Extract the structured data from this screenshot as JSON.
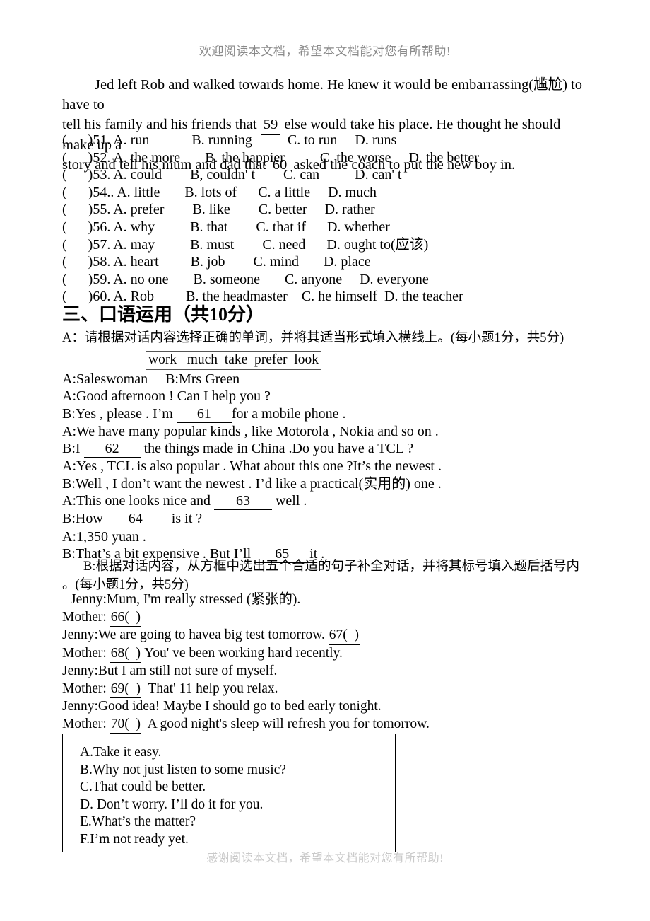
{
  "document": {
    "header_watermark": "欢迎阅读本文档，希望本文档能对您有所帮助!",
    "footer_watermark": "感谢阅读本文档，希望本文档能对您有所帮助!"
  },
  "cloze_passage": {
    "line1_indent": "     ",
    "line1_a": "Jed left Rob and walked towards home. He knew it would be embarrassing(尴尬) to have to",
    "line2_a": "tell his family and his friends that ",
    "line2_blank": "59",
    "line2_b": " else would take his place. He thought he should make up a",
    "line3_a": "story and tell his mum and dad that ",
    "line3_blank": "60",
    "line3_b": " asked the coach to put the new boy in."
  },
  "multiple_choice": {
    "rows": [
      "(      )51. A. run            B. running          C. to run     D. runs",
      "(      )52. A. the more       B. the happier          C. the worse     D. the better",
      "(      )53. A. could        B, couldn' t        C. can          D. can' t",
      "(      )54.. A. little       B. lots of      C. a little     D. much",
      "(      )55. A. prefer        B. like        C. better     D. rather",
      "(      )56. A. why          B. that        C. that if      D. whether",
      "(      )57. A. may          B. must        C. need      D. ought to(应该)",
      "(      )58. A. heart         B. job        C. mind       D. place",
      "(      )59. A. no one       B. someone       C. anyone     D. everyone",
      "(      )60. A. Rob         B. the headmaster    C. he himself  D. the teacher"
    ]
  },
  "section": {
    "heading_prefix": "三、口语运用（共",
    "heading_score": "10",
    "heading_suffix": "分）"
  },
  "part_a": {
    "instruction": "A：请根据对话内容选择正确的单词，并将其适当形式填入横线上。(每小题1分，共5分)",
    "word_bank": "work   much  take  prefer  look",
    "dialogue": [
      {
        "id": "roles",
        "text": "A:Saleswoman     B:Mrs Green"
      },
      {
        "id": "a1",
        "text": "A:Good afternoon ! Can I help you ?"
      },
      {
        "id": "b1_pre",
        "text": "B:Yes , please . I’m ",
        "blank": "61",
        "post": "for a mobile phone ."
      },
      {
        "id": "a2",
        "text": "A:We have many popular kinds , like Motorola , Nokia and so on ."
      },
      {
        "id": "b2_pre",
        "text": "B:I ",
        "blank": "62",
        "post": " the things made in China .Do you have a TCL ?"
      },
      {
        "id": "a3",
        "text": "A:Yes , TCL is also popular . What about this one ?It’s the newest ."
      },
      {
        "id": "b3",
        "text": "B:Well , I don’t want the newest . I’d like a practical(实用的) one ."
      },
      {
        "id": "a4_pre",
        "text": "A:This one looks nice and ",
        "blank": "63",
        "post": " well ."
      },
      {
        "id": "b4_pre",
        "text": "B:How ",
        "blank": "64",
        "post": "  is it ?"
      },
      {
        "id": "a5",
        "text": "A:1,350 yuan ."
      },
      {
        "id": "b5_pre",
        "text": "B:That’s a bit expensive . But I’ll ",
        "blank": "65",
        "post": "it ."
      }
    ]
  },
  "part_b": {
    "instruction_line1": "B:根据对话内容，从方框中选出五个合适的句子补全对话，并将其标号填入题后括号内",
    "instruction_line2": "。(每小题1分，共5分)",
    "dialogue": [
      {
        "id": "j1",
        "speaker": "Jenny:",
        "text": "Mum, I'm really stressed (紧张的)."
      },
      {
        "id": "m1",
        "speaker": "Mother: ",
        "blank": "66(  )",
        "post": ""
      },
      {
        "id": "j2",
        "speaker": "Jenny:",
        "text": "We are going to havea big test tomorrow. ",
        "blank": "67(  )",
        "post": ""
      },
      {
        "id": "m2",
        "speaker": "Mother: ",
        "blank": "68(  )",
        "post": " You' ve been working hard recently."
      },
      {
        "id": "j3",
        "speaker": "Jenny:",
        "text": "But I am still not sure of myself."
      },
      {
        "id": "m3",
        "speaker": "Mother: ",
        "blank": "69(  )",
        "post": "  That' 11 help you relax."
      },
      {
        "id": "j4",
        "speaker": "Jenny:",
        "text": "Good idea! Maybe I should go to bed early tonight."
      },
      {
        "id": "m4",
        "speaker": "Mother: ",
        "blank": "70(  )",
        "post": "  A good night's sleep will refresh you for tomorrow."
      }
    ],
    "options": [
      "A.Take it easy.",
      "B.Why not just listen to some music?",
      "C.That could be better.",
      "D. Don’t worry. I’ll do it for you.",
      "E.What’s the matter?",
      "F.I’m not ready yet."
    ]
  }
}
